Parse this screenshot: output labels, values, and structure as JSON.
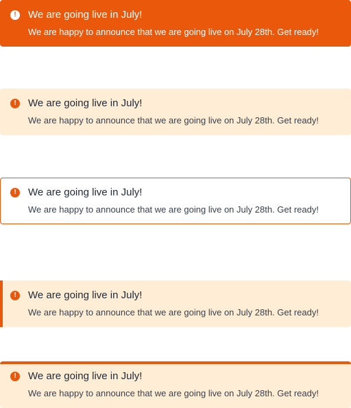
{
  "colors": {
    "accent": "#ea580c",
    "soft_background": "#ffedd5",
    "title_text": "#1f2937",
    "body_text": "#374151"
  },
  "alerts": [
    {
      "variant": "solid",
      "icon": "exclamation-circle-icon",
      "icon_glyph": "!",
      "title": "We are going live in July!",
      "message": "We are happy to announce that we are going live on July 28th. Get ready!"
    },
    {
      "variant": "soft",
      "icon": "exclamation-circle-icon",
      "icon_glyph": "!",
      "title": "We are going live in July!",
      "message": "We are happy to announce that we are going live on July 28th. Get ready!"
    },
    {
      "variant": "outline",
      "icon": "exclamation-circle-icon",
      "icon_glyph": "!",
      "title": "We are going live in July!",
      "message": "We are happy to announce that we are going live on July 28th. Get ready!"
    },
    {
      "variant": "left-accent",
      "icon": "exclamation-circle-icon",
      "icon_glyph": "!",
      "title": "We are going live in July!",
      "message": "We are happy to announce that we are going live on July 28th. Get ready!"
    },
    {
      "variant": "top-accent",
      "icon": "exclamation-circle-icon",
      "icon_glyph": "!",
      "title": "We are going live in July!",
      "message": "We are happy to announce that we are going live on July 28th. Get ready!"
    }
  ]
}
